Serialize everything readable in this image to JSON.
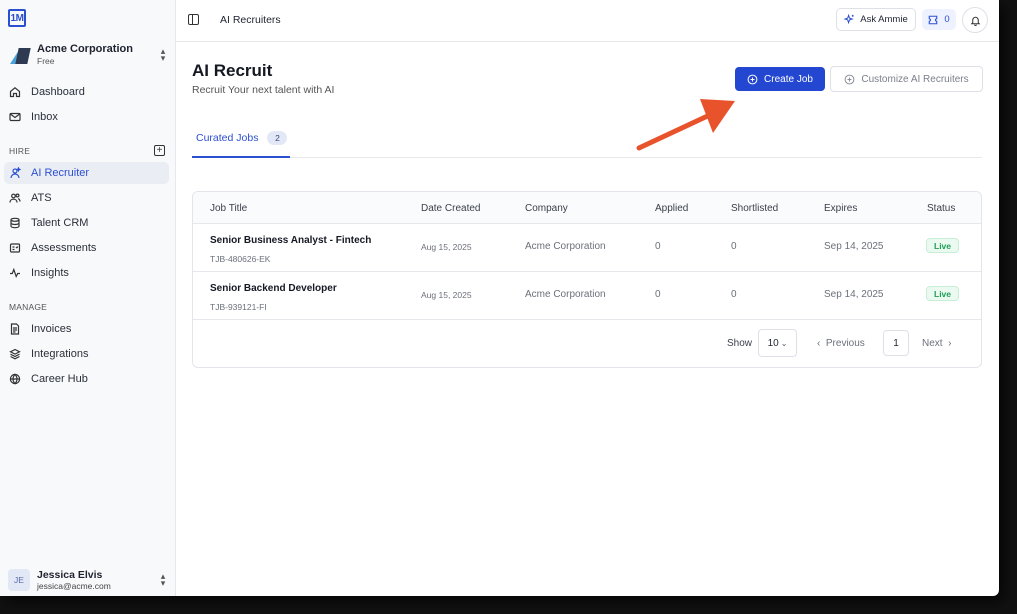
{
  "logo": {
    "text": "1M"
  },
  "org": {
    "name": "Acme Corporation",
    "plan": "Free"
  },
  "sidebar": {
    "top_items": [
      {
        "label": "Dashboard",
        "icon": "home-icon"
      },
      {
        "label": "Inbox",
        "icon": "mail-icon"
      }
    ],
    "hire_label": "HIRE",
    "hire_items": [
      {
        "label": "AI Recruiter",
        "icon": "ai-recruiter-icon",
        "active": true
      },
      {
        "label": "ATS",
        "icon": "users-icon"
      },
      {
        "label": "Talent CRM",
        "icon": "database-icon"
      },
      {
        "label": "Assessments",
        "icon": "assessment-icon"
      },
      {
        "label": "Insights",
        "icon": "activity-icon"
      }
    ],
    "manage_label": "MANAGE",
    "manage_items": [
      {
        "label": "Invoices",
        "icon": "invoice-icon"
      },
      {
        "label": "Integrations",
        "icon": "layers-icon"
      },
      {
        "label": "Career Hub",
        "icon": "globe-icon"
      }
    ]
  },
  "user": {
    "initials": "JE",
    "name": "Jessica Elvis",
    "email": "jessica@acme.com"
  },
  "topbar": {
    "breadcrumb": "AI Recruiters",
    "ask_label": "Ask Ammie",
    "credits": "0"
  },
  "main": {
    "title": "AI Recruit",
    "subtitle": "Recruit Your next talent with AI",
    "create_label": "Create Job",
    "customize_label": "Customize AI Recruiters",
    "tab_label": "Curated Jobs",
    "tab_count": "2"
  },
  "table": {
    "headers": [
      "Job Title",
      "Date Created",
      "Company",
      "Applied",
      "Shortlisted",
      "Expires",
      "Status"
    ],
    "rows": [
      {
        "title": "Senior Business Analyst - Fintech",
        "id": "TJB-480626-EK",
        "date": "Aug 15, 2025",
        "company": "Acme Corporation",
        "applied": "0",
        "shortlisted": "0",
        "expires": "Sep 14, 2025",
        "status": "Live"
      },
      {
        "title": "Senior Backend Developer",
        "id": "TJB-939121-FI",
        "date": "Aug 15, 2025",
        "company": "Acme Corporation",
        "applied": "0",
        "shortlisted": "0",
        "expires": "Sep 14, 2025",
        "status": "Live"
      }
    ]
  },
  "pagination": {
    "show_label": "Show",
    "page_size": "10",
    "prev_label": "Previous",
    "page": "1",
    "next_label": "Next"
  },
  "colors": {
    "accent": "#2347d1",
    "annotation_arrow": "#e8532c",
    "live_green": "#1f9d55"
  }
}
